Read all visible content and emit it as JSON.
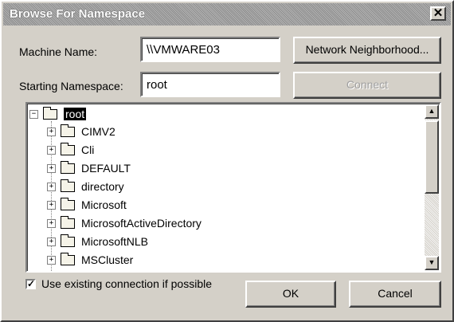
{
  "window": {
    "title": "Browse For Namespace",
    "close_glyph": "✕"
  },
  "machine": {
    "label": "Machine Name:",
    "value": "\\\\VMWARE03"
  },
  "namespace": {
    "label": "Starting Namespace:",
    "value": "root"
  },
  "buttons": {
    "network": "Network Neighborhood...",
    "connect": "Connect",
    "ok": "OK",
    "cancel": "Cancel"
  },
  "tree": {
    "root": "root",
    "root_expander": "−",
    "child_expander": "+",
    "children": [
      "CIMV2",
      "Cli",
      "DEFAULT",
      "directory",
      "Microsoft",
      "MicrosoftActiveDirectory",
      "MicrosoftNLB",
      "MSCluster"
    ]
  },
  "checkbox": {
    "label": "Use existing connection if possible",
    "checked": true,
    "check_glyph": "✓"
  },
  "scrollbar": {
    "up_glyph": "▲",
    "down_glyph": "▼"
  }
}
